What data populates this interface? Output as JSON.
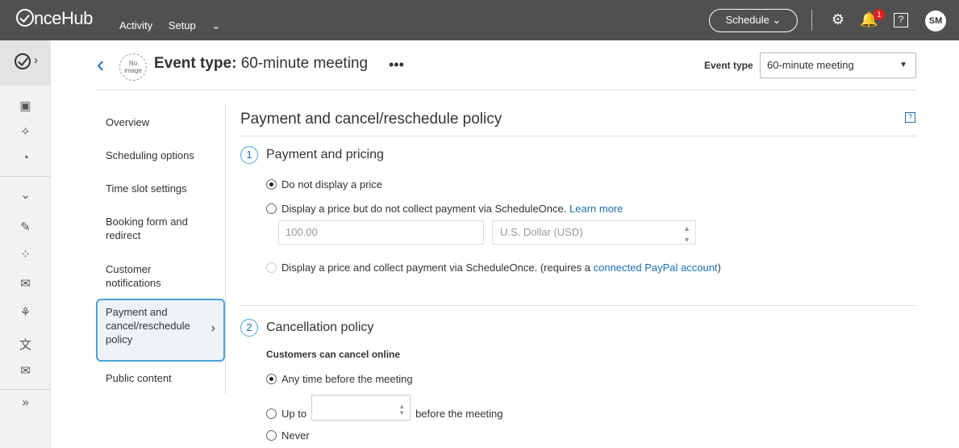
{
  "topbar": {
    "logo": "OnceHub",
    "nav": [
      "Activity",
      "Setup"
    ],
    "schedule_label": "Schedule",
    "notification_count": "1",
    "help": "?",
    "avatar_initials": "SM"
  },
  "header": {
    "no_image": "No image",
    "title_prefix": "Event type:",
    "title_name": "60-minute meeting",
    "more": "•••",
    "event_type_label": "Event type",
    "event_type_value": "60-minute meeting"
  },
  "menu": {
    "items": [
      "Overview",
      "Scheduling options",
      "Time slot settings",
      "Booking form and redirect",
      "Customer notifications",
      "Payment and cancel/reschedule policy",
      "Public content"
    ]
  },
  "content": {
    "title": "Payment and cancel/reschedule policy",
    "help": "?",
    "payment": {
      "step": "1",
      "title": "Payment and pricing",
      "opt_none": "Do not display a price",
      "opt_display": "Display a price but do not collect payment via ScheduleOnce.",
      "learn_more": "Learn more",
      "price_placeholder": "100.00",
      "currency": "U.S. Dollar (USD)",
      "opt_collect": "Display a price and collect payment via ScheduleOnce. (requires a",
      "paypal_link": "connected PayPal account",
      "paren_close": ")"
    },
    "cancellation": {
      "step": "2",
      "title": "Cancellation policy",
      "sub_label": "Customers can cancel online",
      "opt_any": "Any time before the meeting",
      "opt_upto": "Up to",
      "opt_upto_suffix": "before the meeting",
      "opt_never": "Never"
    }
  }
}
